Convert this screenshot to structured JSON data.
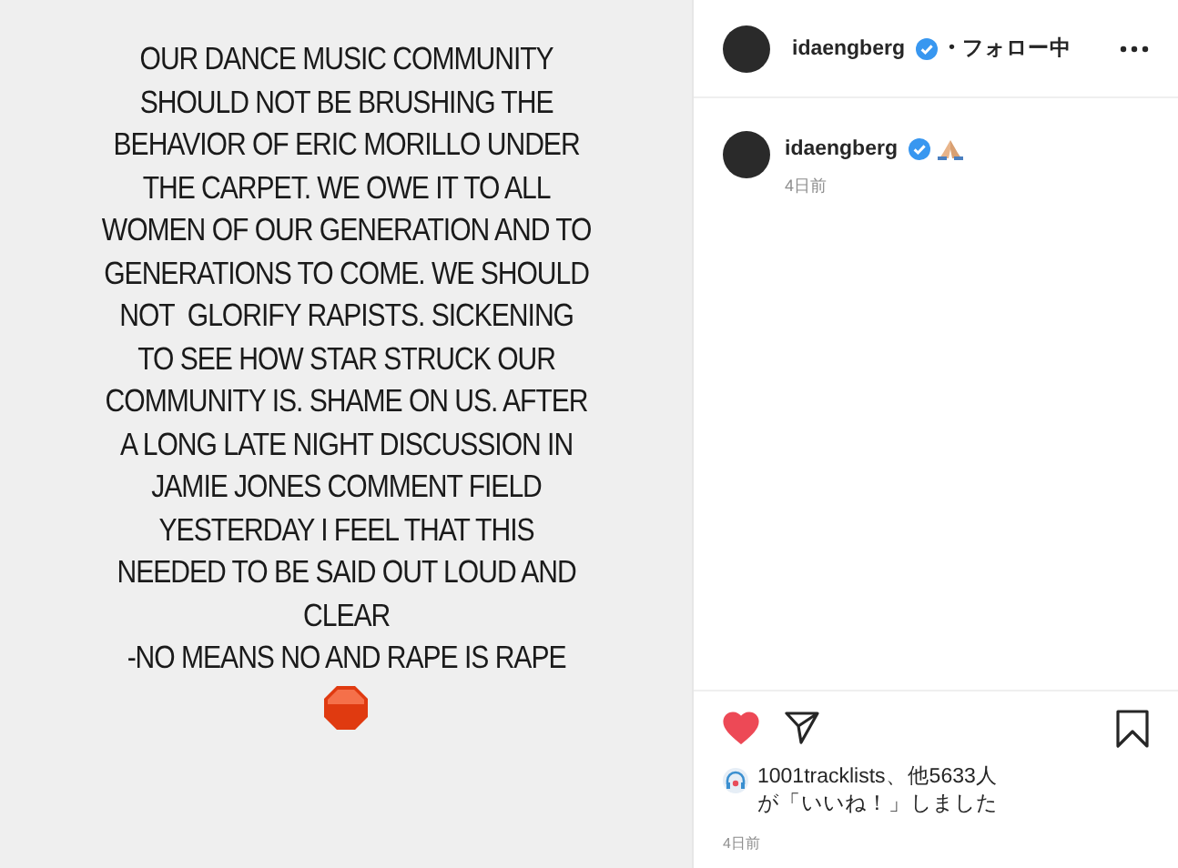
{
  "post_image": {
    "lines": [
      "OUR DANCE MUSIC COMMUNITY",
      "SHOULD NOT BE BRUSHING THE",
      "BEHAVIOR OF ERIC MORILLO UNDER",
      "THE CARPET. WE OWE IT TO ALL",
      "WOMEN OF OUR GENERATION AND TO",
      "GENERATIONS TO COME. WE SHOULD",
      "NOT  GLORIFY RAPISTS. SICKENING",
      "TO SEE HOW STAR STRUCK OUR",
      "COMMUNITY IS. SHAME ON US. AFTER",
      "A LONG LATE NIGHT DISCUSSION IN",
      "JAMIE JONES COMMENT FIELD",
      "YESTERDAY I FEEL THAT THIS",
      "NEEDED TO BE SAID OUT LOUD AND",
      "CLEAR",
      "-NO MEANS NO AND RAPE IS RAPE"
    ]
  },
  "header": {
    "username": "idaengberg",
    "verified": true,
    "separator": "•",
    "follow_status": "フォロー中"
  },
  "caption": {
    "username": "idaengberg",
    "verified": true,
    "age": "4日前"
  },
  "actions": {
    "liked": true,
    "saved": false
  },
  "likes": {
    "lines": [
      "1001tracklists、他5633人",
      "が「いいね！」しました"
    ]
  },
  "timestamp": "4日前"
}
